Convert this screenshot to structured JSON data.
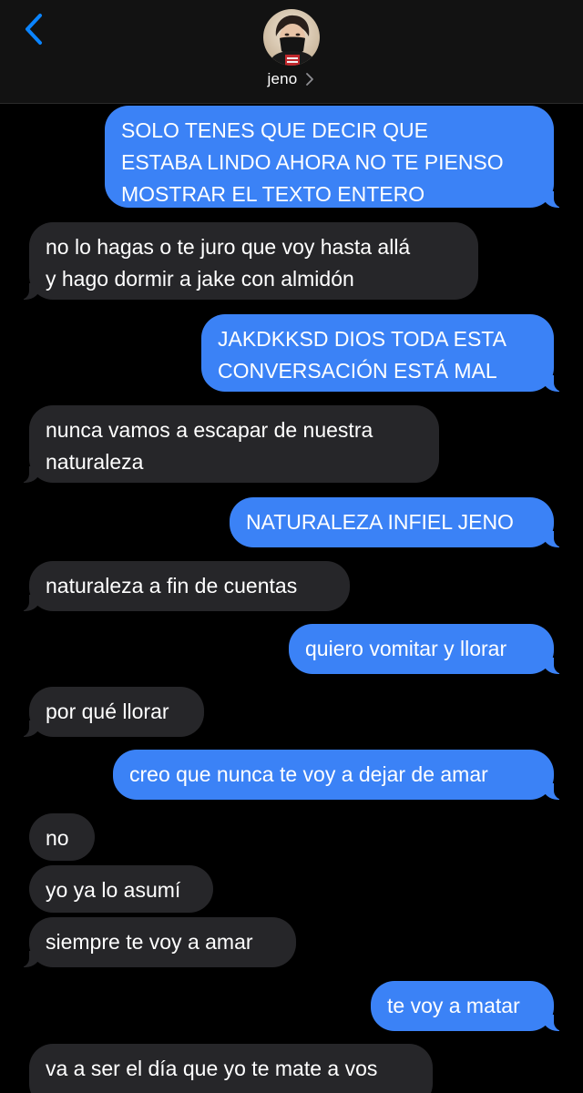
{
  "header": {
    "contact_name": "jeno",
    "back_icon": "chevron-left-icon",
    "disclosure_icon": "chevron-right-icon"
  },
  "colors": {
    "sent_bubble": "#3b82f6",
    "received_bubble": "#262629",
    "background": "#000000",
    "accent": "#0a84ff"
  },
  "messages": [
    {
      "from": "me",
      "lines": [
        "SOLO TENES QUE DECIR QUE",
        "ESTABA LINDO AHORA NO TE PIENSO",
        "MOSTRAR EL TEXTO ENTERO"
      ]
    },
    {
      "from": "them",
      "lines": [
        "no lo hagas o te juro que voy hasta allá",
        "y hago dormir a jake con almidón"
      ]
    },
    {
      "from": "me",
      "lines": [
        "JAKDKKSD DIOS TODA ESTA",
        "CONVERSACIÓN ESTÁ MAL"
      ]
    },
    {
      "from": "them",
      "lines": [
        "nunca vamos a escapar de nuestra",
        "naturaleza"
      ]
    },
    {
      "from": "me",
      "lines": [
        "NATURALEZA INFIEL JENO"
      ]
    },
    {
      "from": "them",
      "lines": [
        "naturaleza a fin de cuentas"
      ]
    },
    {
      "from": "me",
      "lines": [
        "quiero vomitar y llorar"
      ]
    },
    {
      "from": "them",
      "lines": [
        "por qué llorar"
      ]
    },
    {
      "from": "me",
      "lines": [
        "creo que nunca te voy a dejar de amar"
      ]
    },
    {
      "from": "them",
      "lines": [
        "no"
      ]
    },
    {
      "from": "them",
      "lines": [
        "yo ya lo asumí"
      ]
    },
    {
      "from": "them",
      "lines": [
        "siempre te voy a amar"
      ]
    },
    {
      "from": "me",
      "lines": [
        "te voy a matar"
      ]
    },
    {
      "from": "them",
      "lines": [
        "va a ser el día que yo te mate a vos"
      ]
    }
  ]
}
